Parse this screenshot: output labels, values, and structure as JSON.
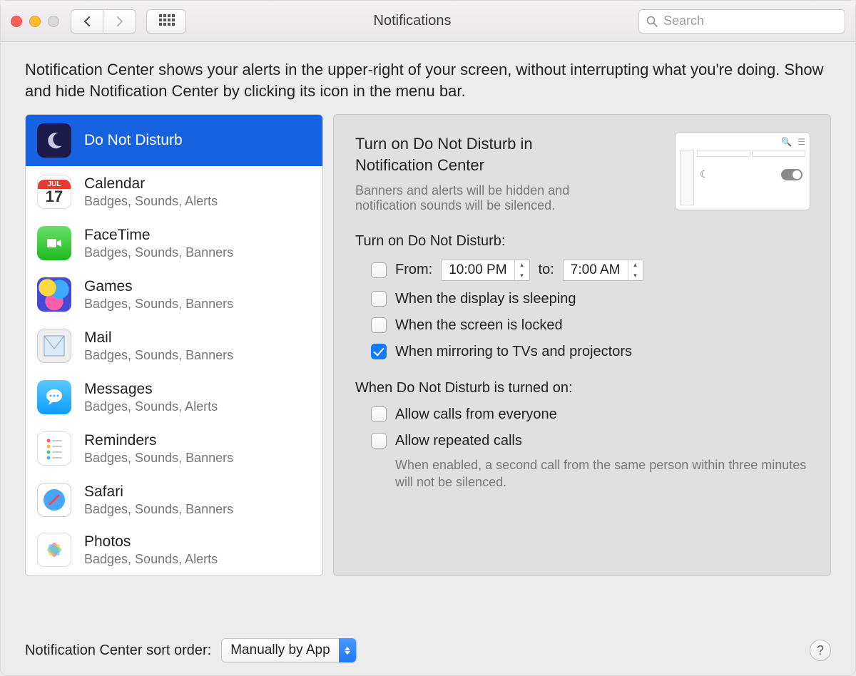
{
  "window": {
    "title": "Notifications"
  },
  "search": {
    "placeholder": "Search"
  },
  "description": "Notification Center shows your alerts in the upper-right of your screen, without interrupting what you're doing. Show and hide Notification Center by clicking its icon in the menu bar.",
  "sidebar": [
    {
      "name": "Do Not Disturb",
      "sub": "",
      "icon": "moon",
      "selected": true
    },
    {
      "name": "Calendar",
      "sub": "Badges, Sounds, Alerts",
      "icon": "calendar"
    },
    {
      "name": "FaceTime",
      "sub": "Badges, Sounds, Banners",
      "icon": "facetime"
    },
    {
      "name": "Games",
      "sub": "Badges, Sounds, Banners",
      "icon": "games"
    },
    {
      "name": "Mail",
      "sub": "Badges, Sounds, Banners",
      "icon": "mail"
    },
    {
      "name": "Messages",
      "sub": "Badges, Sounds, Alerts",
      "icon": "messages"
    },
    {
      "name": "Reminders",
      "sub": "Badges, Sounds, Banners",
      "icon": "reminders"
    },
    {
      "name": "Safari",
      "sub": "Badges, Sounds, Banners",
      "icon": "safari"
    },
    {
      "name": "Photos",
      "sub": "Badges, Sounds, Alerts",
      "icon": "photos"
    }
  ],
  "panel": {
    "heading": "Turn on Do Not Disturb in Notification Center",
    "sub": "Banners and alerts will be hidden and notification sounds will be silenced.",
    "section1": "Turn on Do Not Disturb:",
    "from_label": "From:",
    "from_time": "10:00 PM",
    "to_label": "to:",
    "to_time": "7:00 AM",
    "opt_sleep": "When the display is sleeping",
    "opt_locked": "When the screen is locked",
    "opt_mirror": "When mirroring to TVs and projectors",
    "section2": "When Do Not Disturb is turned on:",
    "opt_calls": "Allow calls from everyone",
    "opt_repeat": "Allow repeated calls",
    "repeat_hint": "When enabled, a second call from the same person within three minutes will not be silenced.",
    "checks": {
      "from": false,
      "sleep": false,
      "locked": false,
      "mirror": true,
      "calls": false,
      "repeat": false
    }
  },
  "footer": {
    "label": "Notification Center sort order:",
    "select_value": "Manually by App"
  },
  "calendar_icon": {
    "month": "JUL",
    "day": "17"
  }
}
